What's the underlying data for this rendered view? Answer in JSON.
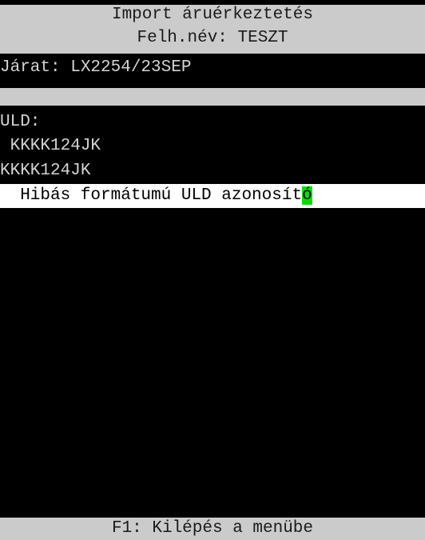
{
  "header": {
    "title": "Import áruérkeztetés",
    "user_line": "Felh.név: TESZT"
  },
  "flight": {
    "label_line": "Járat: LX2254/23SEP"
  },
  "uld": {
    "label": "ULD:",
    "value_indented": " KKKK124JK",
    "input_value": "KKKK124JK"
  },
  "error": {
    "message_prefix": "  Hibás formátumú ULD azonosít",
    "message_cursor_char": "ó"
  },
  "footer": {
    "hint": "F1: Kilépés a menübe"
  },
  "colors": {
    "bar_gray": "#cbcbcb",
    "screen_black": "#000000",
    "text_light": "#d4d4d4",
    "error_bg": "#ffffff",
    "cursor_green": "#00e000"
  }
}
